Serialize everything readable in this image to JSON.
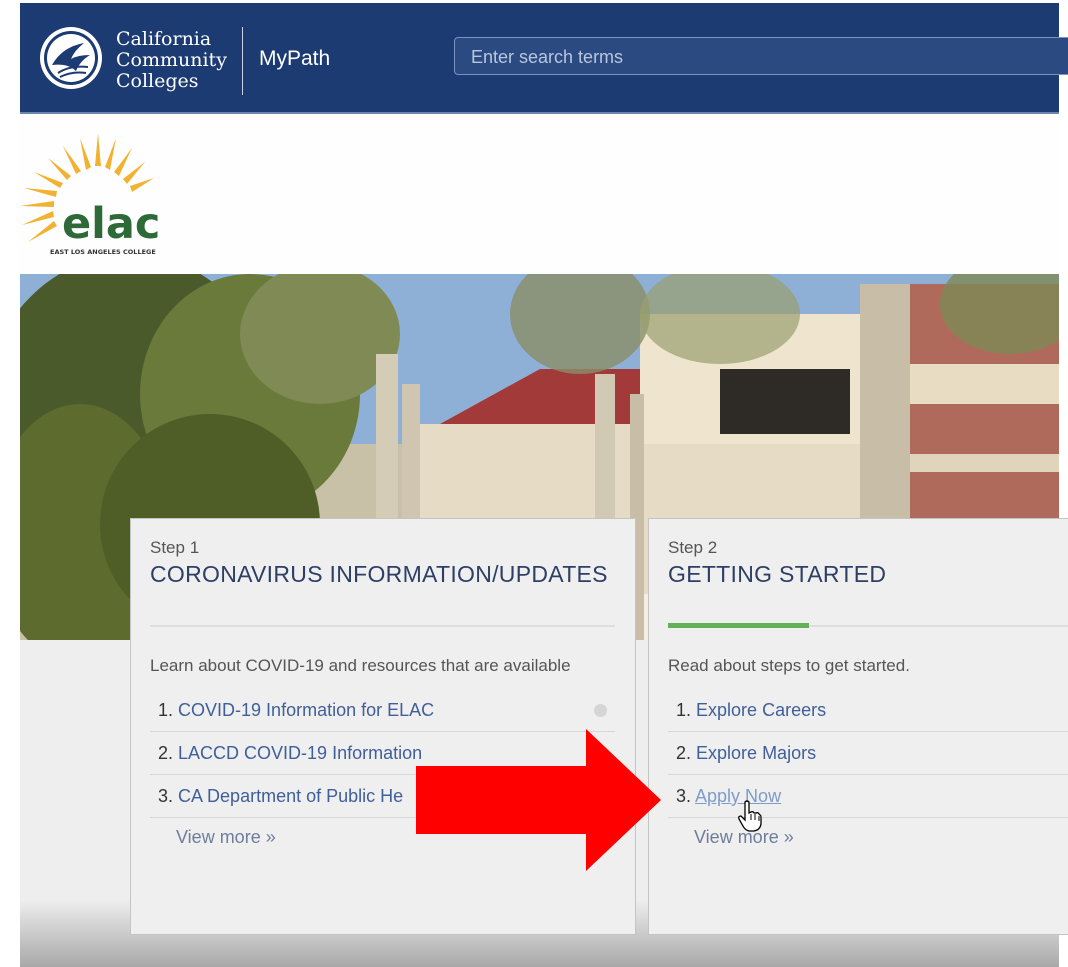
{
  "header": {
    "brand_line1": "California",
    "brand_line2": "Community",
    "brand_line3": "Colleges",
    "app_name": "MyPath",
    "search_placeholder": "Enter search terms",
    "background_color": "#1c3b72"
  },
  "college": {
    "logo_text": "elac",
    "logo_subtext": "EAST LOS ANGELES COLLEGE"
  },
  "cards": [
    {
      "step": "Step 1",
      "title": "CORONAVIRUS INFORMATION/UPDATES",
      "description": "Learn about COVID-19 and resources that are available",
      "items": [
        {
          "number": "1.",
          "label": "COVID-19 Information for ELAC"
        },
        {
          "number": "2.",
          "label": "LACCD COVID-19 Information"
        },
        {
          "number": "3.",
          "label": "CA Department of Public He"
        }
      ],
      "view_more": "View more »"
    },
    {
      "step": "Step 2",
      "title": "GETTING STARTED",
      "description": "Read about steps to get started.",
      "items": [
        {
          "number": "1.",
          "label": "Explore Careers"
        },
        {
          "number": "2.",
          "label": "Explore Majors"
        },
        {
          "number": "3.",
          "label": "Apply Now"
        }
      ],
      "view_more": "View more »"
    }
  ],
  "colors": {
    "accent_green": "#62b15a",
    "link_blue": "#3f5f9a",
    "annotation_arrow": "#ff0000"
  }
}
